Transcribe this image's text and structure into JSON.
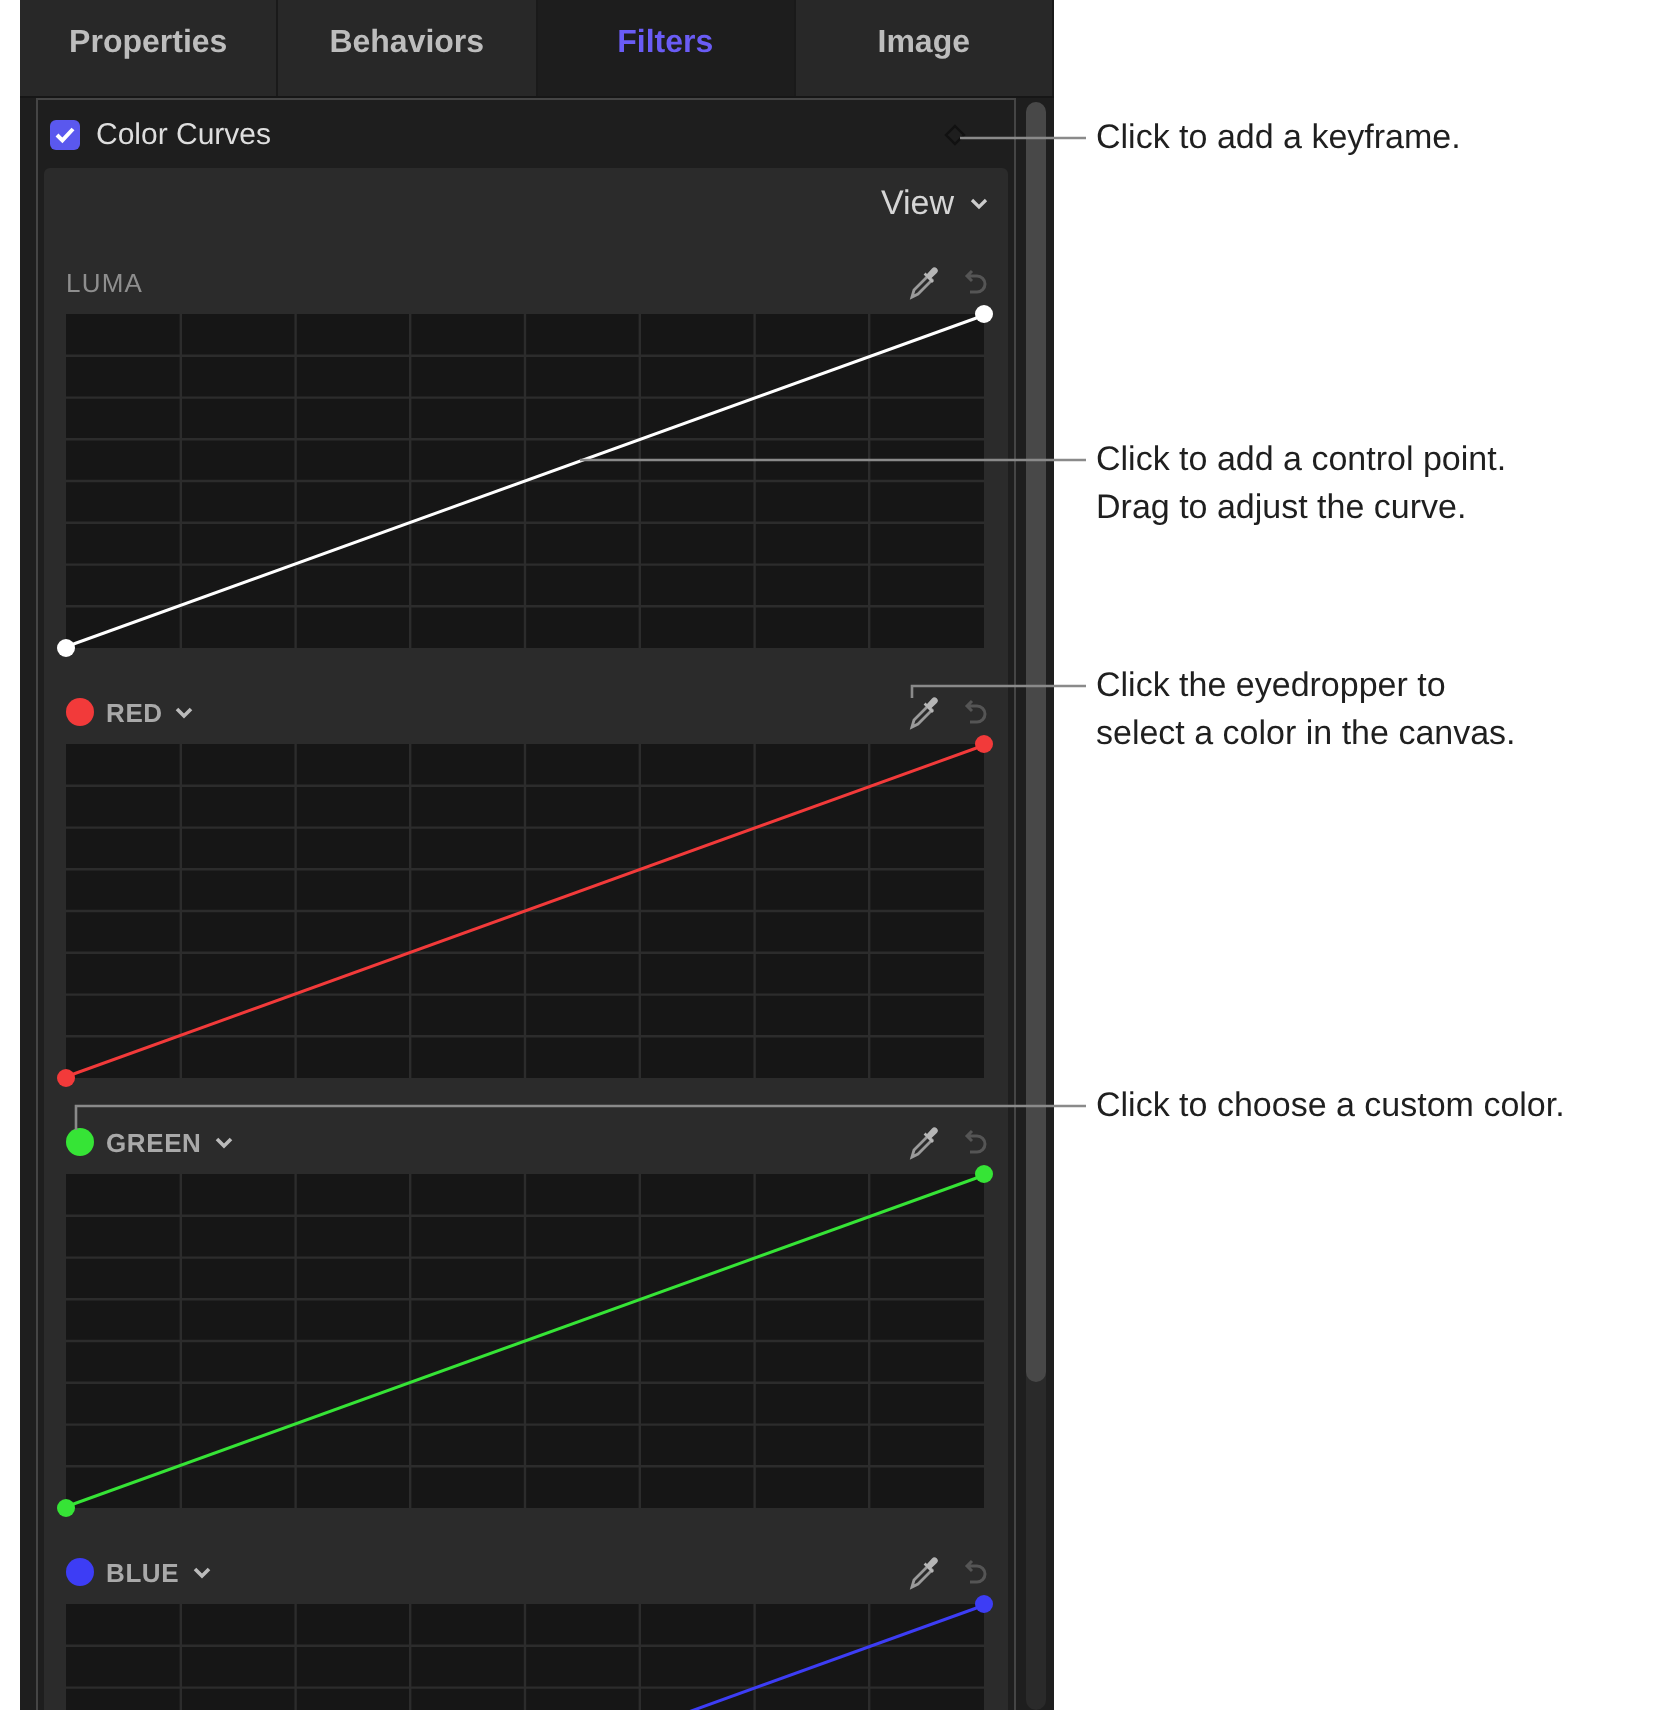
{
  "tabs": [
    {
      "label": "Properties",
      "selected": false
    },
    {
      "label": "Behaviors",
      "selected": false
    },
    {
      "label": "Filters",
      "selected": true
    },
    {
      "label": "Image",
      "selected": false
    }
  ],
  "effect": {
    "title": "Color Curves",
    "enabled": true,
    "view_menu": "View",
    "curves": [
      {
        "kind": "luma",
        "label": "LUMA",
        "color": "#ffffff"
      },
      {
        "kind": "channel",
        "label": "RED",
        "color": "#f23a3a"
      },
      {
        "kind": "channel",
        "label": "GREEN",
        "color": "#36e436"
      },
      {
        "kind": "channel",
        "label": "BLUE",
        "color": "#3d3df5"
      }
    ]
  },
  "callouts": [
    {
      "text": "Click to add a keyframe."
    },
    {
      "text": "Click to add a control point.\nDrag to adjust the curve."
    },
    {
      "text": "Click the eyedropper to\nselect a color in the canvas."
    },
    {
      "text": "Click to choose a custom color."
    }
  ]
}
